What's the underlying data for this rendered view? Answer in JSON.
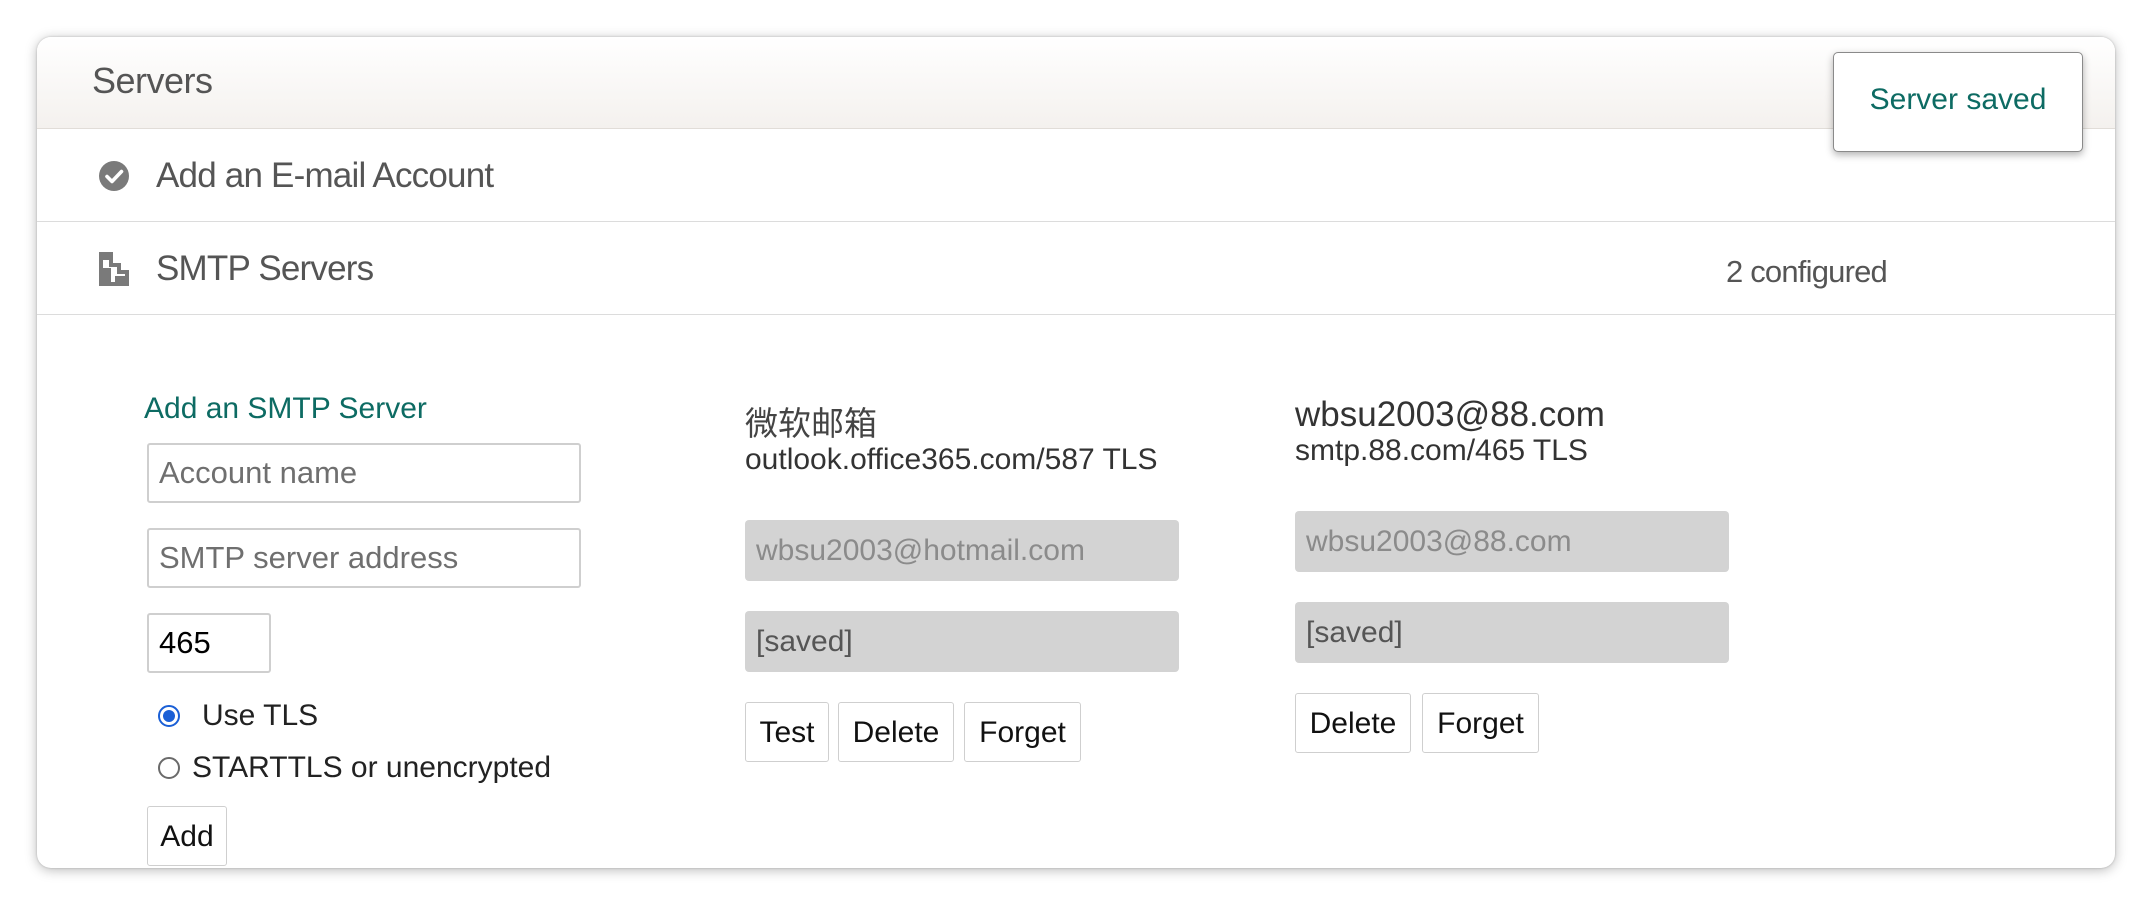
{
  "panel": {
    "title": "Servers"
  },
  "toast": {
    "text": "Server saved"
  },
  "sections": {
    "email_account": {
      "icon": "check-circle-icon",
      "label": "Add an E-mail Account"
    },
    "smtp_servers": {
      "icon": "server-doc-icon",
      "label": "SMTP Servers",
      "count": "2 configured"
    }
  },
  "add_form": {
    "title": "Add an SMTP Server",
    "account_placeholder": "Account name",
    "address_placeholder": "SMTP server address",
    "port_value": "465",
    "tls_label": "Use TLS",
    "starttls_label": "STARTTLS or unencrypted",
    "tls_selected": "Use TLS",
    "add_label": "Add"
  },
  "servers": [
    {
      "name": "微软邮箱",
      "host": "outlook.office365.com/587 TLS",
      "username": "wbsu2003@hotmail.com",
      "password": "[saved]",
      "buttons": {
        "test": "Test",
        "delete": "Delete",
        "forget": "Forget"
      }
    },
    {
      "name": "wbsu2003@88.com",
      "host": "smtp.88.com/465 TLS",
      "username": "wbsu2003@88.com",
      "password": "[saved]",
      "buttons": {
        "delete": "Delete",
        "forget": "Forget"
      }
    }
  ],
  "colors": {
    "accent": "#0d6b63",
    "radio": "#1a5fd6",
    "disabled_bg": "#d3d3d3"
  }
}
